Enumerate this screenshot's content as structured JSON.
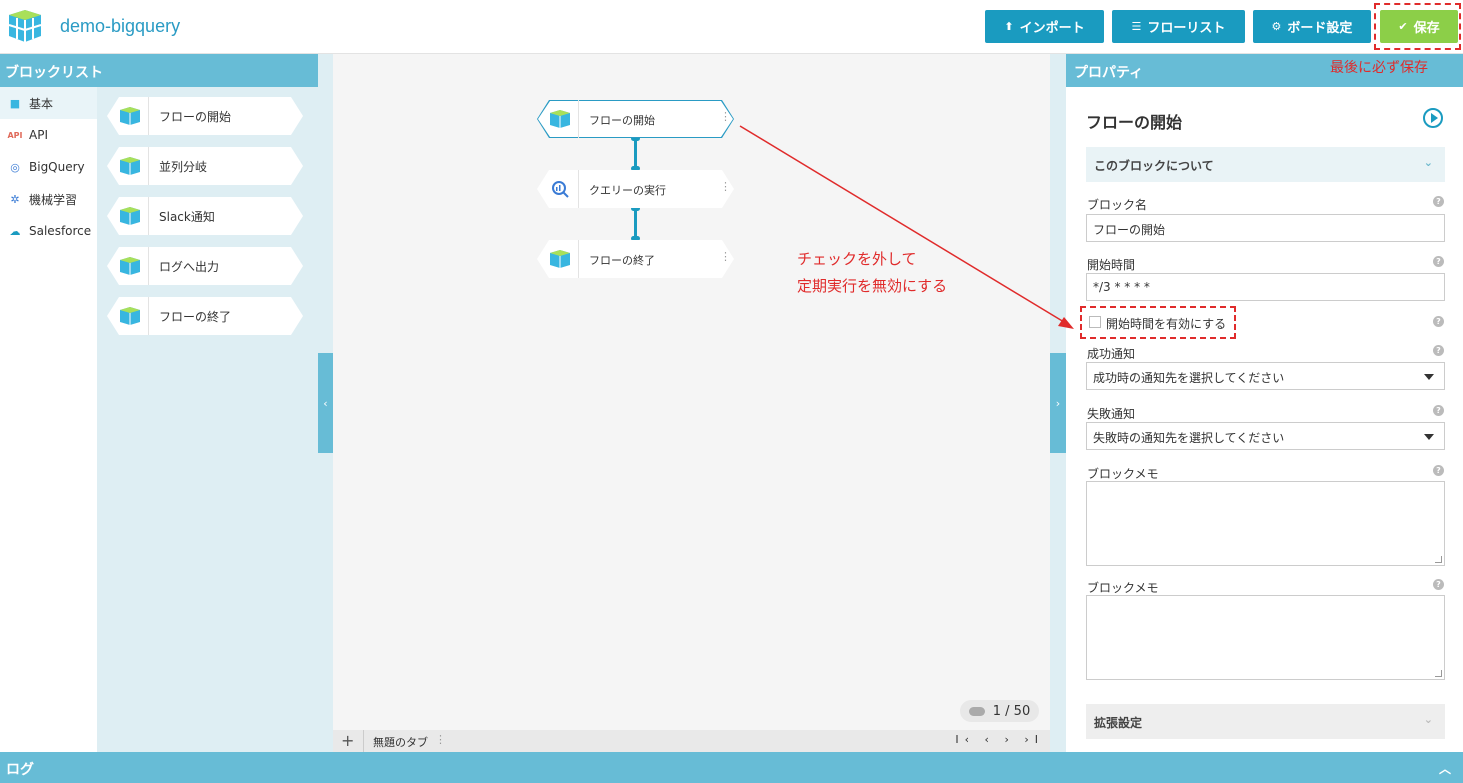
{
  "app": {
    "title": "demo-bigquery"
  },
  "toolbar": {
    "import_label": "インポート",
    "flowlist_label": "フローリスト",
    "board_label": "ボード設定",
    "save_label": "保存",
    "save_note": "最後に必ず保存"
  },
  "left_panel": {
    "title": "ブロックリスト",
    "categories": [
      {
        "label": "基本",
        "icon": "cube-icon"
      },
      {
        "label": "API",
        "icon": "api-icon"
      },
      {
        "label": "BigQuery",
        "icon": "bigquery-icon"
      },
      {
        "label": "機械学習",
        "icon": "brain-icon"
      },
      {
        "label": "Salesforce",
        "icon": "cloud-icon"
      }
    ],
    "blocks": [
      "フローの開始",
      "並列分岐",
      "Slack通知",
      "ログへ出力",
      "フローの終了"
    ]
  },
  "canvas": {
    "nodes": [
      "フローの開始",
      "クエリーの実行",
      "フローの終了"
    ],
    "annotation_line1": "チェックを外して",
    "annotation_line2": "定期実行を無効にする",
    "page_indicator": "1 / 50",
    "tab_name": "無題のタブ",
    "tab_add": "+",
    "tab_nav": "I‹ ‹ › ›I"
  },
  "properties": {
    "panel_title": "プロパティ",
    "block_title": "フローの開始",
    "about_section": "このブロックについて",
    "block_name_label": "ブロック名",
    "block_name_value": "フローの開始",
    "start_time_label": "開始時間",
    "start_time_value": "*/3 * * * *",
    "enable_start_label": "開始時間を有効にする",
    "success_label": "成功通知",
    "success_select": "成功時の通知先を選択してください",
    "failure_label": "失敗通知",
    "failure_select": "失敗時の通知先を選択してください",
    "memo_label_1": "ブロックメモ",
    "memo_label_2": "ブロックメモ",
    "extended_label": "拡張設定"
  },
  "footer": {
    "log_label": "ログ"
  },
  "colors": {
    "accent": "#1a9bc0",
    "save": "#8ccf48",
    "header_bar": "#67bcd6",
    "annotation": "#e02b2b"
  }
}
